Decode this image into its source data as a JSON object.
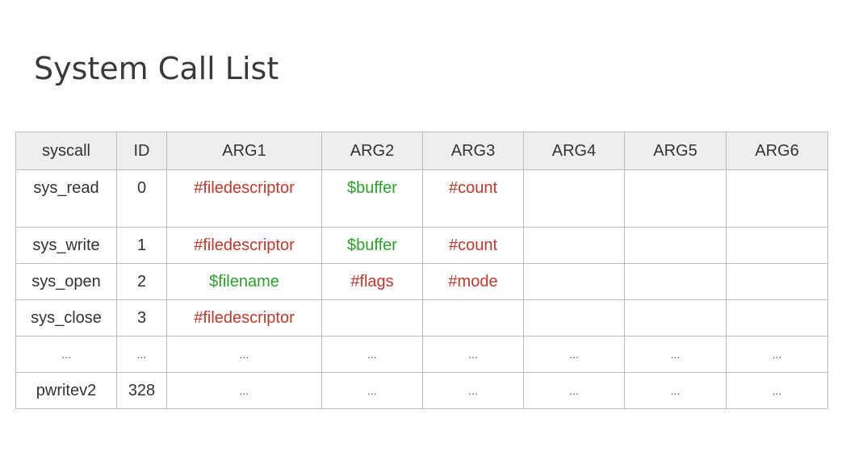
{
  "title": "System Call List",
  "colors": {
    "fd_arg": "#c0392b",
    "pointer_arg": "#2ca02c",
    "header_bg": "#eeeeee",
    "border": "#bdbdbd"
  },
  "table": {
    "headers": [
      "syscall",
      "ID",
      "ARG1",
      "ARG2",
      "ARG3",
      "ARG4",
      "ARG5",
      "ARG6"
    ],
    "rows": [
      {
        "cells": [
          "sys_read",
          "0",
          "#filedescriptor",
          "$buffer",
          "#count",
          "",
          "",
          ""
        ]
      },
      {
        "cells": [
          "sys_write",
          "1",
          "#filedescriptor",
          "$buffer",
          "#count",
          "",
          "",
          ""
        ]
      },
      {
        "cells": [
          "sys_open",
          "2",
          "$filename",
          "#flags",
          "#mode",
          "",
          "",
          ""
        ]
      },
      {
        "cells": [
          "sys_close",
          "3",
          "#filedescriptor",
          "",
          "",
          "",
          "",
          ""
        ]
      },
      {
        "cells": [
          "...",
          "...",
          "...",
          "...",
          "...",
          "...",
          "...",
          "..."
        ]
      },
      {
        "cells": [
          "pwritev2",
          "328",
          "...",
          "...",
          "...",
          "...",
          "...",
          "..."
        ]
      }
    ]
  }
}
